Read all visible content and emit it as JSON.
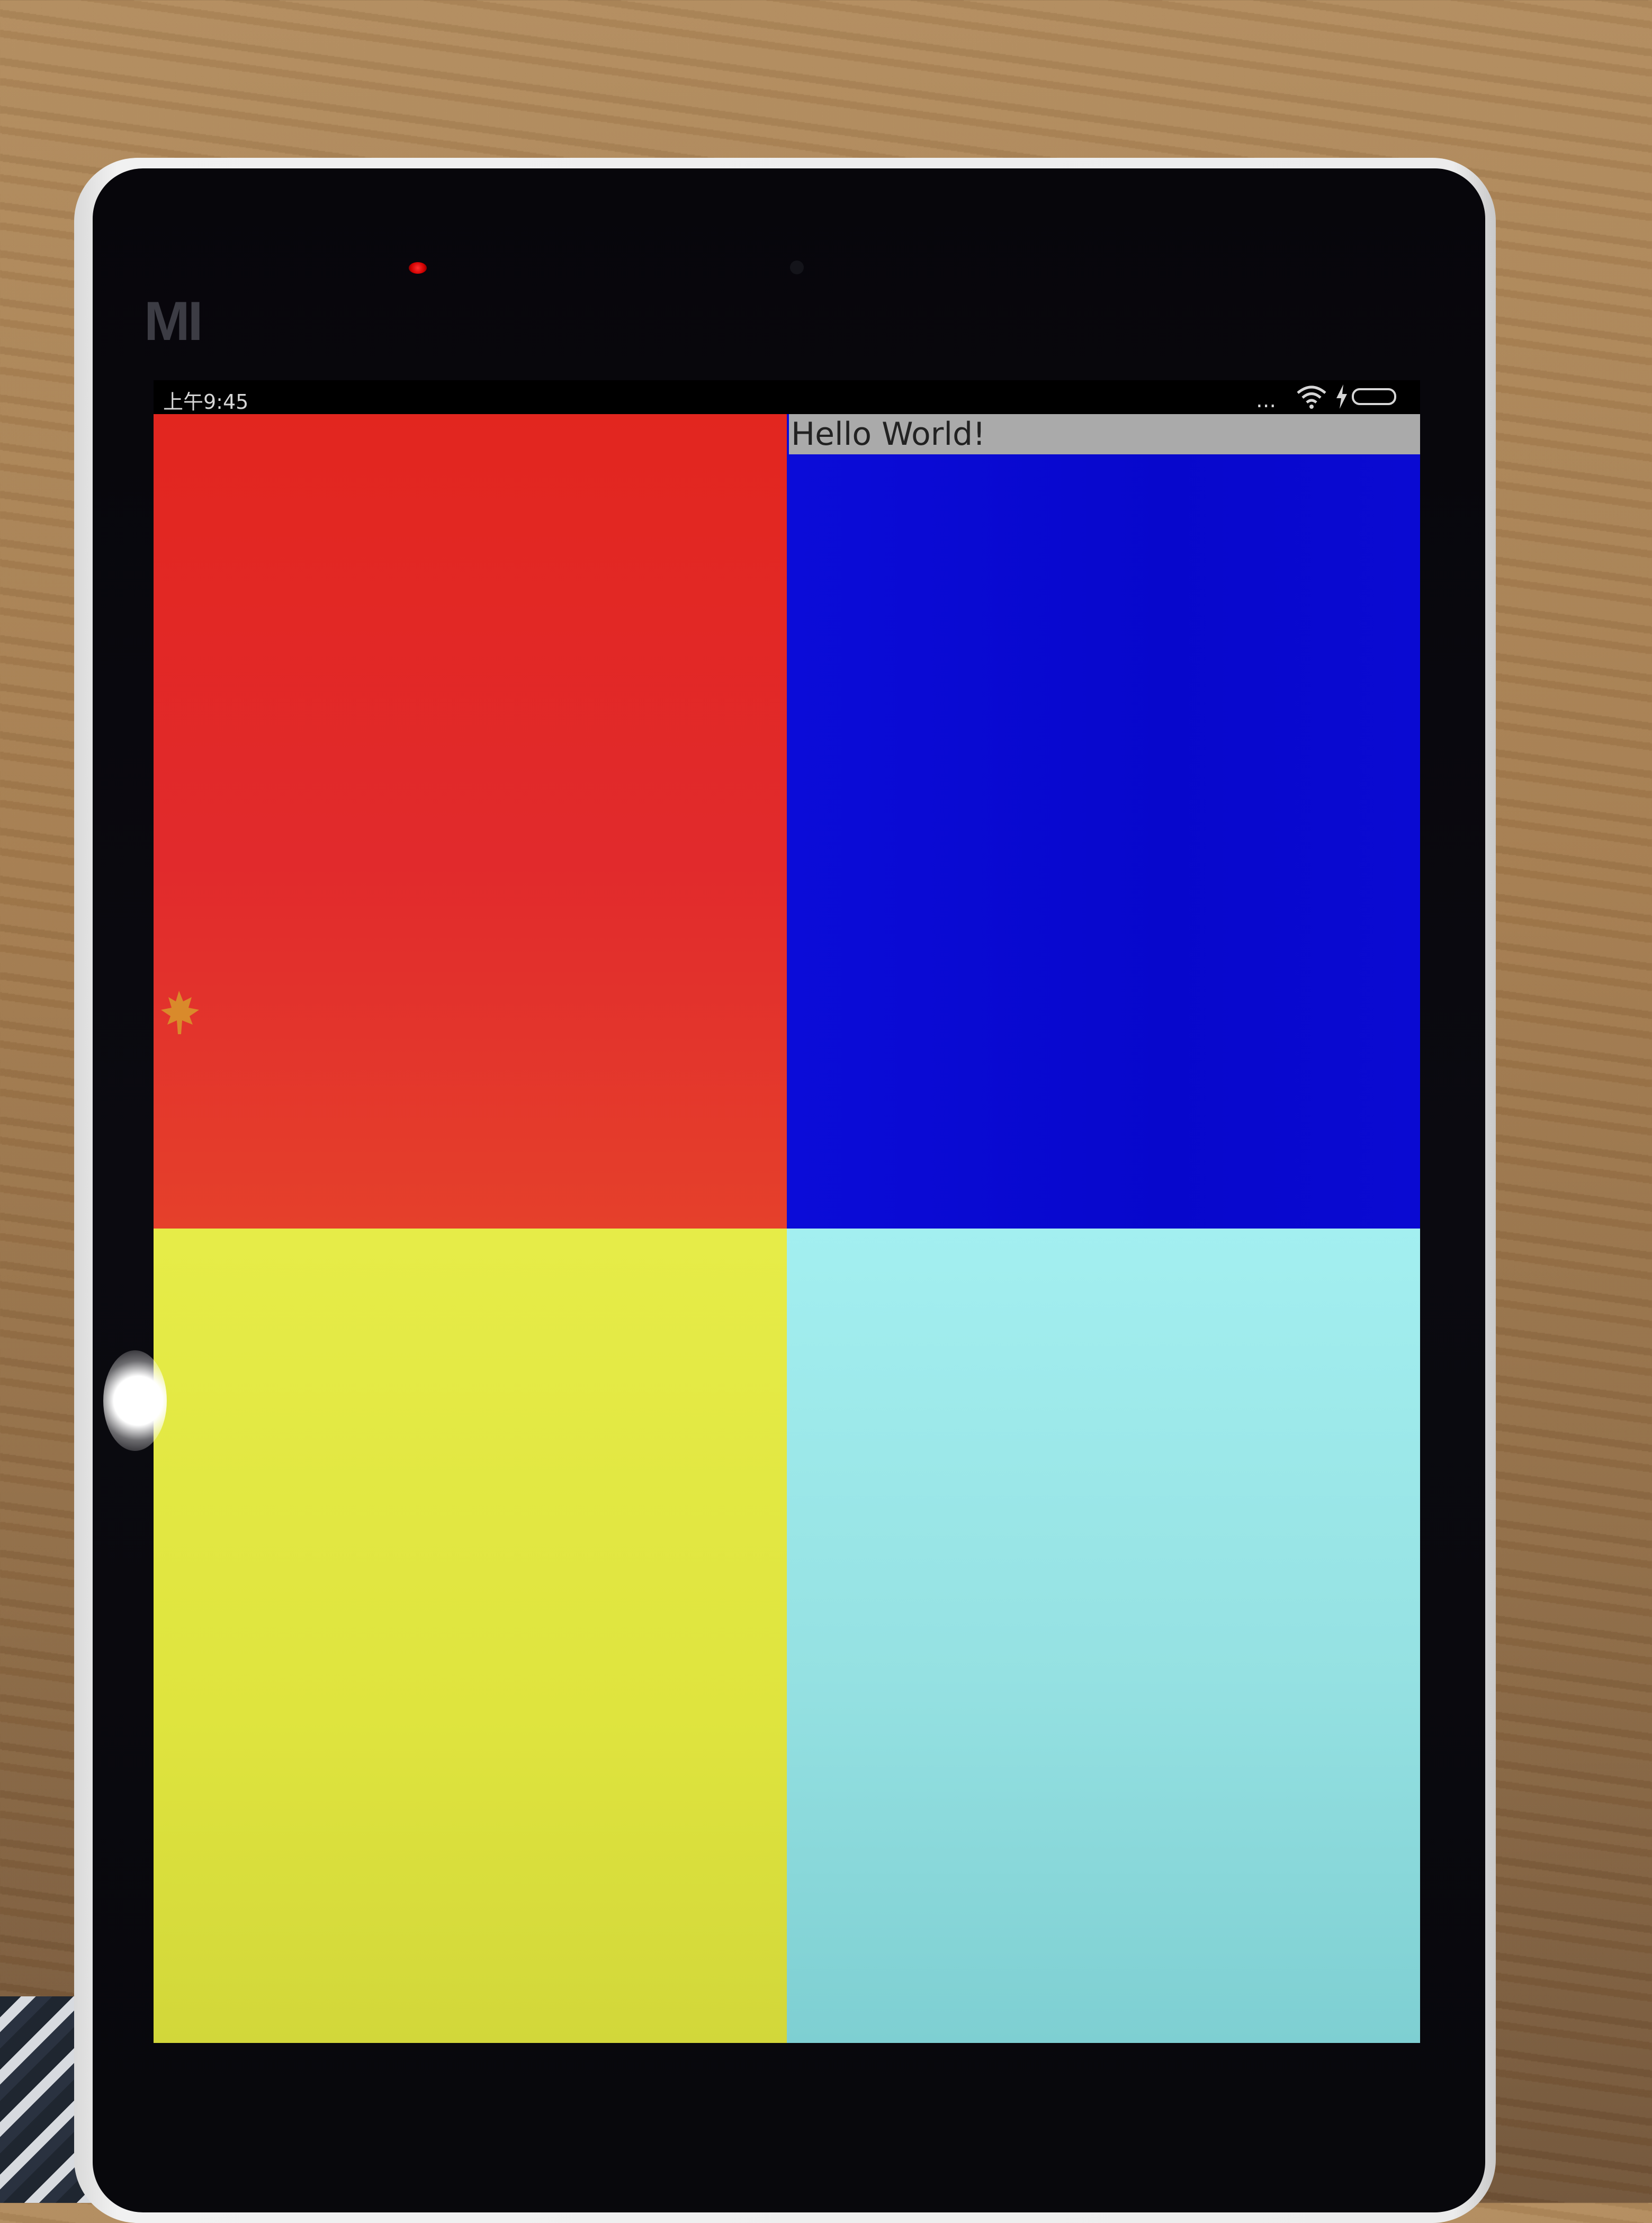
{
  "device": {
    "brand_logo": "MI"
  },
  "status_bar": {
    "time": "上午9:45",
    "overflow_indicator": "...",
    "icons": [
      "overflow-dots-icon",
      "wifi-icon",
      "charging-bolt-icon",
      "battery-icon"
    ]
  },
  "app": {
    "hello_text": "Hello World!",
    "quadrants": [
      {
        "name": "top-left",
        "color": "#e2261f"
      },
      {
        "name": "top-right",
        "color": "#0808d0"
      },
      {
        "name": "bottom-left",
        "color": "#e0e540"
      },
      {
        "name": "bottom-right",
        "color": "#95e1e2"
      }
    ],
    "hello_background": "#aaaaaa"
  }
}
